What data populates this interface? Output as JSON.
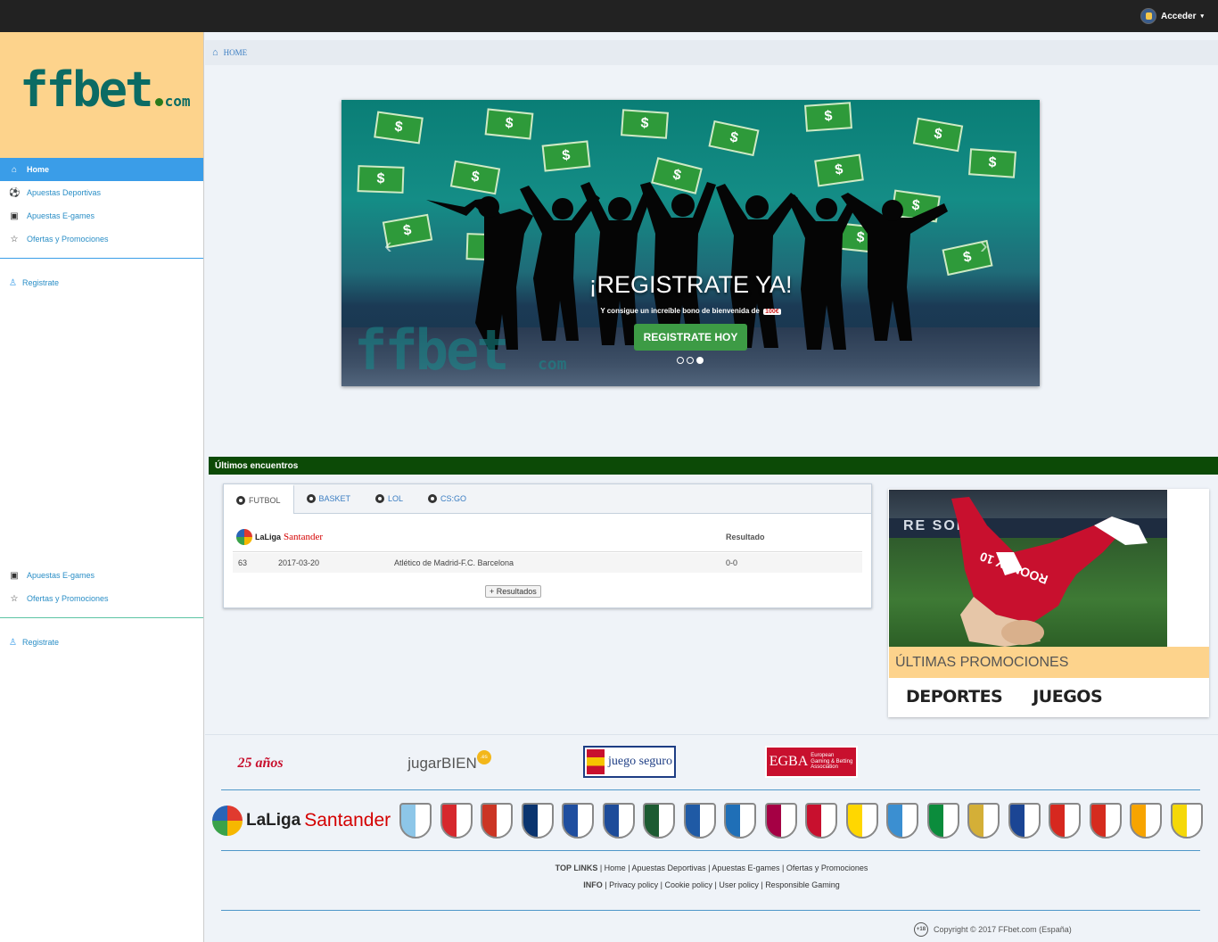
{
  "topbar": {
    "login_label": "Acceder"
  },
  "sidebar": {
    "logo_main": "ffbet",
    "logo_tld": "com",
    "items": [
      {
        "label": "Home",
        "icon": "home-icon"
      },
      {
        "label": "Apuestas Deportivas",
        "icon": "soccer-ball-icon"
      },
      {
        "label": "Apuestas E-games",
        "icon": "gamepad-icon"
      },
      {
        "label": "Ofertas y Promociones",
        "icon": "star-icon"
      }
    ],
    "register_label": "Registrate",
    "duplicate_items": [
      {
        "label": "Apuestas E-games",
        "icon": "gamepad-icon"
      },
      {
        "label": "Ofertas y Promociones",
        "icon": "star-icon"
      }
    ]
  },
  "breadcrumb": {
    "home": "HOME"
  },
  "carousel": {
    "title": "¡REGISTRATE YA!",
    "subtitle": "Y consigue un increíble bono de bienvenida de",
    "bonus_badge": "100€",
    "cta_label": "REGISTRATE HOY",
    "watermark": "ffbet",
    "watermark_tld": "com",
    "slides_count": 3,
    "active_slide": 3
  },
  "results": {
    "section_title": "Últimos encuentros",
    "tabs": [
      "FUTBOL",
      "BASKET",
      "LOL",
      "CS:GO"
    ],
    "active_tab": "FUTBOL",
    "league_brand": "LaLiga",
    "league_sponsor": "Santander",
    "result_header": "Resultado",
    "rows": [
      {
        "id": "63",
        "date": "2017-03-20",
        "match": "Atlético de Madrid-F.C. Barcelona",
        "result": "0-0"
      }
    ],
    "more_button": "+ Resultados"
  },
  "promo": {
    "board_text": "RE    SONY",
    "player_text": "ROONEY 10",
    "bar_title": "ÚLTIMAS PROMOCIONES",
    "links": [
      "DEPORTES",
      "JUEGOS"
    ]
  },
  "footer": {
    "partners": [
      "25 años",
      "jugarBIEN",
      "juego seguro",
      "EGBA"
    ],
    "partner_badge": ".es",
    "egba_sub": "European Gaming & Betting Association",
    "league_brand": "LaLiga",
    "league_sponsor": "Santander",
    "clubs": [
      {
        "name": "Celta",
        "color": "#8dc6e8"
      },
      {
        "name": "Athletic",
        "color": "#d6282d"
      },
      {
        "name": "Atlético",
        "color": "#cb3524"
      },
      {
        "name": "Osasuna",
        "color": "#0a346f"
      },
      {
        "name": "Deportivo",
        "color": "#1f4e9f"
      },
      {
        "name": "Eibar",
        "color": "#1e4c9a"
      },
      {
        "name": "Leganés",
        "color": "#1d5b32"
      },
      {
        "name": "Alavés",
        "color": "#1f5aa5"
      },
      {
        "name": "Espanyol",
        "color": "#1f6fb7"
      },
      {
        "name": "Barcelona",
        "color": "#a50044"
      },
      {
        "name": "Granada",
        "color": "#c8102e"
      },
      {
        "name": "Las Palmas",
        "color": "#ffd700"
      },
      {
        "name": "Málaga",
        "color": "#3b8fd1"
      },
      {
        "name": "Betis",
        "color": "#0b8c3c"
      },
      {
        "name": "Real Madrid",
        "color": "#d4af37"
      },
      {
        "name": "Real Sociedad",
        "color": "#1b4594"
      },
      {
        "name": "Sevilla",
        "color": "#d6281f"
      },
      {
        "name": "Sporting",
        "color": "#d52b1e"
      },
      {
        "name": "Valencia",
        "color": "#f7a400"
      },
      {
        "name": "Villarreal",
        "color": "#f5d808"
      }
    ],
    "top_links_label": "TOP LINKS",
    "top_links": [
      "Home",
      "Apuestas Deportivas",
      "Apuestas E-games",
      "Ofertas y Promociones"
    ],
    "info_label": "INFO",
    "info_links": [
      "Privacy policy",
      "Cookie policy",
      "User policy",
      "Responsible Gaming"
    ],
    "age_badge": "+18",
    "copyright": "Copyright © 2017 FFbet.com (España)"
  },
  "colors": {
    "sidebar_active": "#3a9de8",
    "logo_bg": "#fdd38c",
    "section_header": "#0c4a06",
    "cta_green": "#3d9b45",
    "link_blue": "#2a8ec6"
  }
}
